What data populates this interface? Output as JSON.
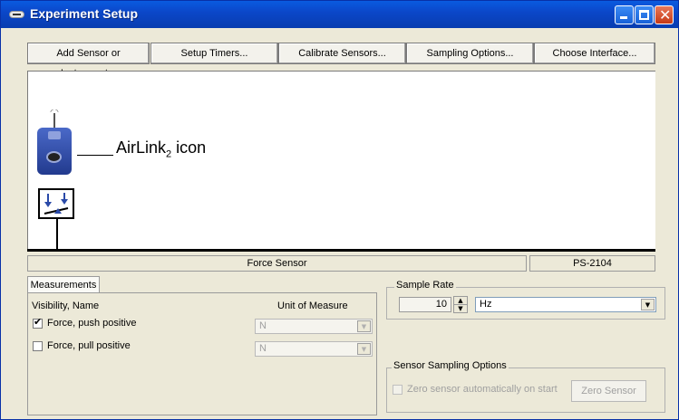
{
  "window": {
    "title": "Experiment Setup",
    "close_glyph": "✕"
  },
  "toolbar": {
    "add_sensor_label": "Add Sensor or Instrument...",
    "setup_timers_label": "Setup Timers...",
    "calibrate_label": "Calibrate Sensors...",
    "sampling_options_label": "Sampling Options...",
    "choose_interface_label": "Choose Interface..."
  },
  "canvas": {
    "airlink_label": "AirLink",
    "airlink_subscript": "2",
    "airlink_suffix": " icon",
    "airlink_icon": "airlink-device-icon",
    "sensor_icon": "force-sensor-icon"
  },
  "status": {
    "sensor_name": "Force Sensor",
    "part_number": "PS-2104"
  },
  "measurements": {
    "tab_label": "Measurements",
    "col_visibility": "Visibility, Name",
    "col_unit": "Unit of Measure",
    "rows": [
      {
        "name": "Force, push positive",
        "checked": true,
        "unit": "N"
      },
      {
        "name": "Force, pull positive",
        "checked": false,
        "unit": "N"
      }
    ],
    "check_glyph": "✔"
  },
  "sample_rate": {
    "legend": "Sample Rate",
    "value": "10",
    "unit": "Hz"
  },
  "sensor_sampling": {
    "legend": "Sensor Sampling Options",
    "zero_on_start_label": "Zero sensor automatically on start",
    "zero_sensor_button": "Zero Sensor"
  },
  "colors": {
    "titlebar": "#0b47c9",
    "close_button": "#c63a16",
    "window_bg": "#ece9d8"
  }
}
